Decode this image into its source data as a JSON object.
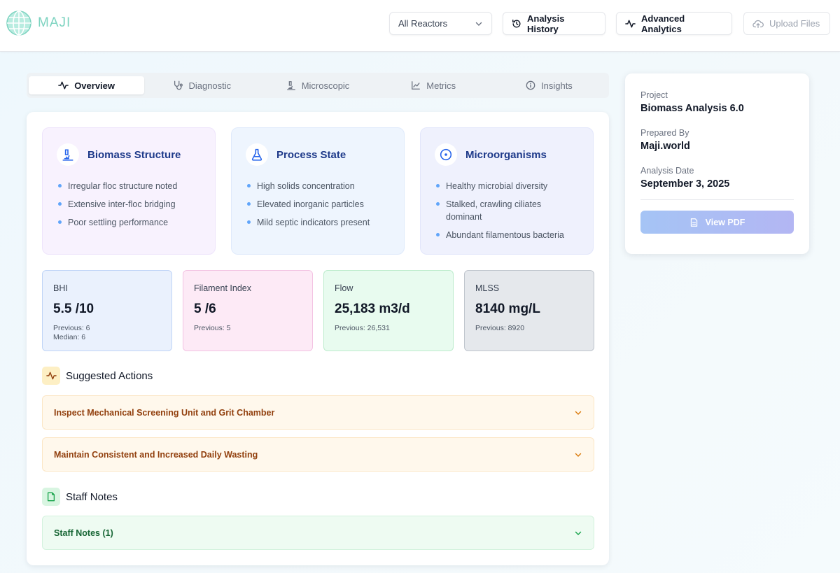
{
  "header": {
    "logo_text": "MAJI",
    "reactor_select": "All Reactors",
    "analysis_history": "Analysis History",
    "advanced_analytics": "Advanced Analytics",
    "upload_files": "Upload Files"
  },
  "tabs": [
    {
      "label": "Overview",
      "icon": "activity-icon",
      "active": true
    },
    {
      "label": "Diagnostic",
      "icon": "stethoscope-icon",
      "active": false
    },
    {
      "label": "Microscopic",
      "icon": "microscope-icon",
      "active": false
    },
    {
      "label": "Metrics",
      "icon": "line-chart-icon",
      "active": false
    },
    {
      "label": "Insights",
      "icon": "info-icon",
      "active": false
    }
  ],
  "info_boxes": [
    {
      "title": "Biomass Structure",
      "icon": "microscope-icon",
      "items": [
        "Irregular floc structure noted",
        "Extensive inter-floc bridging",
        "Poor settling performance"
      ]
    },
    {
      "title": "Process State",
      "icon": "flask-icon",
      "items": [
        "High solids concentration",
        "Elevated inorganic particles",
        "Mild septic indicators present"
      ]
    },
    {
      "title": "Microorganisms",
      "icon": "target-icon",
      "items": [
        "Healthy microbial diversity",
        "Stalked, crawling ciliates dominant",
        "Abundant filamentous bacteria"
      ]
    }
  ],
  "metrics": [
    {
      "label": "BHI",
      "value": "5.5 /10",
      "sub1": "Previous: 6",
      "sub2": "Median: 6"
    },
    {
      "label": "Filament Index",
      "value": "5 /6",
      "sub1": "Previous: 5",
      "sub2": ""
    },
    {
      "label": "Flow",
      "value": "25,183 m3/d",
      "sub1": "Previous: 26,531",
      "sub2": ""
    },
    {
      "label": "MLSS",
      "value": "8140 mg/L",
      "sub1": "Previous: 8920",
      "sub2": ""
    }
  ],
  "suggested_actions": {
    "title": "Suggested Actions",
    "items": [
      "Inspect Mechanical Screening Unit and Grit Chamber",
      "Maintain Consistent and Increased Daily Wasting"
    ]
  },
  "staff_notes": {
    "title": "Staff Notes",
    "item": "Staff Notes (1)"
  },
  "side": {
    "project_label": "Project",
    "project_value": "Biomass Analysis 6.0",
    "prepared_label": "Prepared By",
    "prepared_value": "Maji.world",
    "date_label": "Analysis Date",
    "date_value": "September 3, 2025",
    "pdf_button": "View PDF"
  },
  "colors": {
    "accent_blue": "#1e3a8a",
    "amber_text": "#92400e",
    "green_text": "#166534",
    "logo": "#7dd3c0"
  }
}
